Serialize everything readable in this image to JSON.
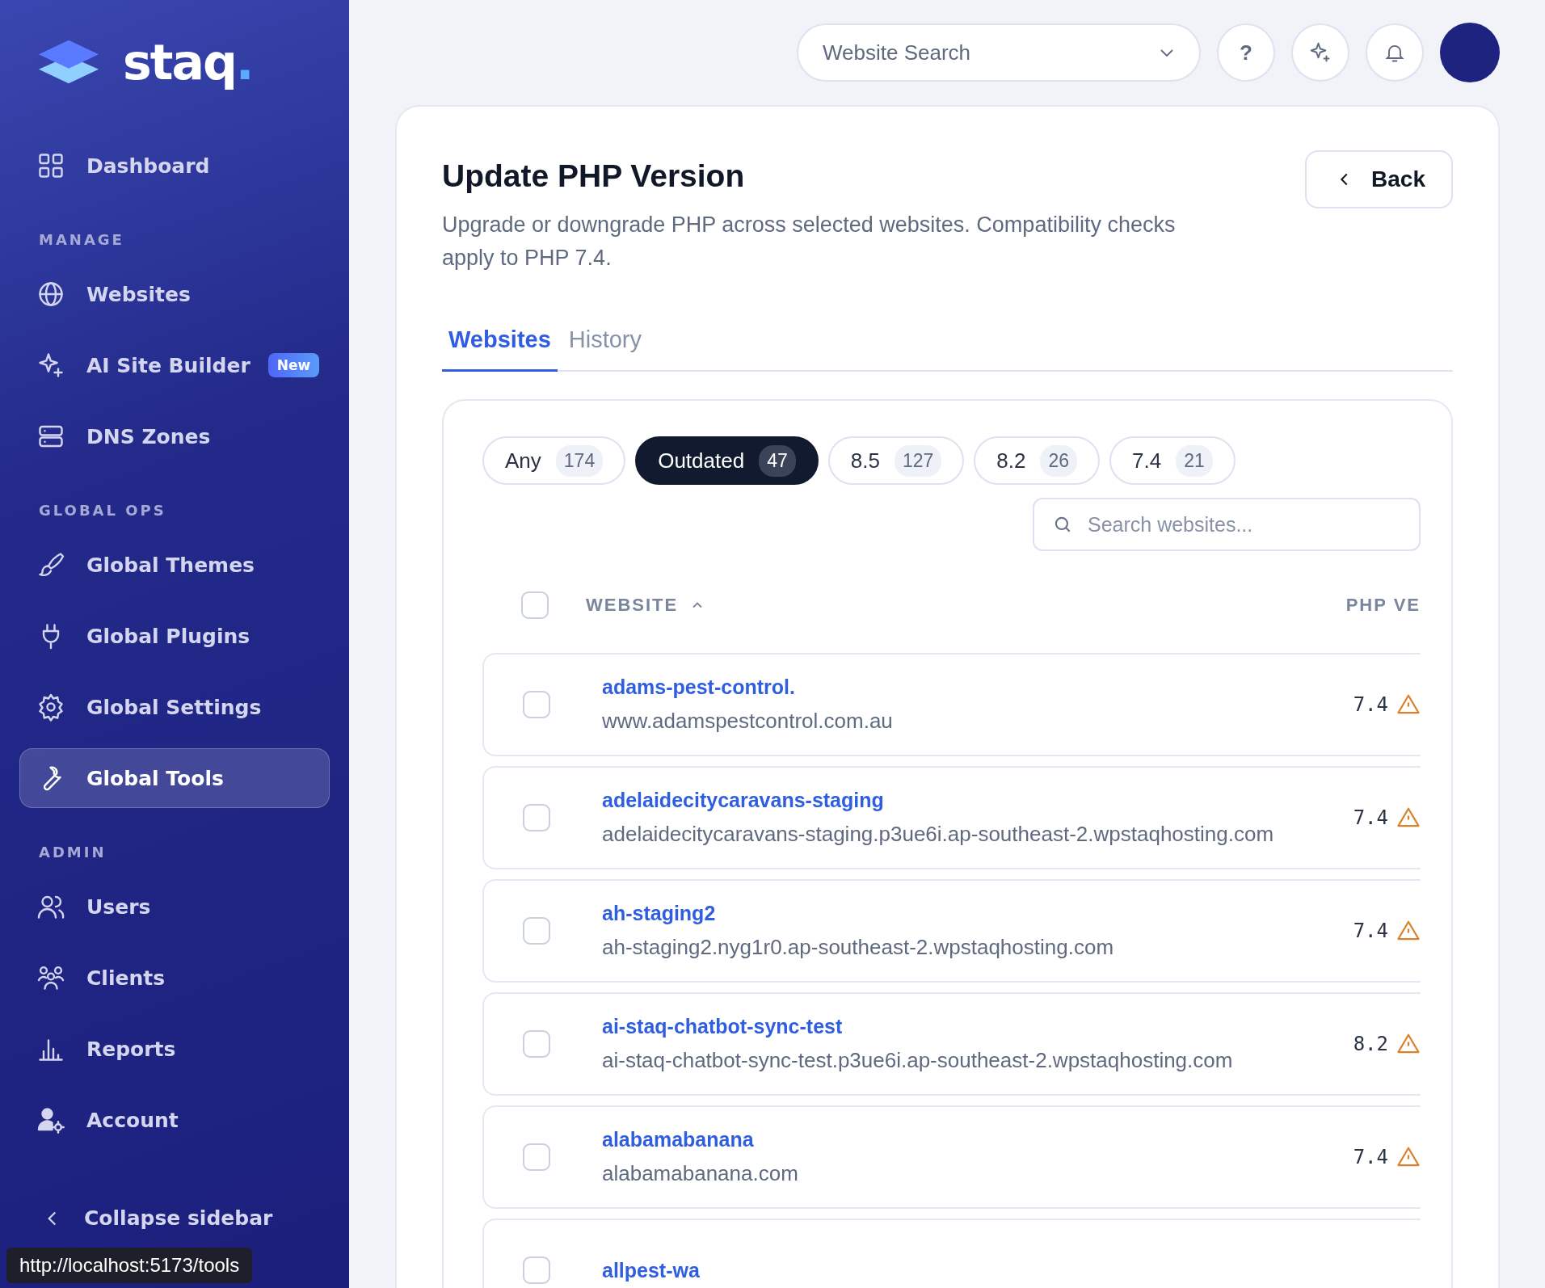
{
  "sidebar": {
    "logo": {
      "text": "staq",
      "dot": "."
    },
    "sections": [
      {
        "items": [
          {
            "label": "Dashboard",
            "selected": false
          }
        ]
      },
      {
        "heading": "MANAGE",
        "items": [
          {
            "label": "Websites",
            "selected": false
          },
          {
            "label": "AI Site Builder",
            "badge": "New",
            "selected": false
          },
          {
            "label": "DNS Zones",
            "selected": false
          }
        ]
      },
      {
        "heading": "GLOBAL OPS",
        "items": [
          {
            "label": "Global Themes",
            "selected": false
          },
          {
            "label": "Global Plugins",
            "selected": false
          },
          {
            "label": "Global Settings",
            "selected": false
          },
          {
            "label": "Global Tools",
            "selected": true
          }
        ]
      },
      {
        "heading": "ADMIN",
        "items": [
          {
            "label": "Users",
            "selected": false
          },
          {
            "label": "Clients",
            "selected": false
          },
          {
            "label": "Reports",
            "selected": false
          },
          {
            "label": "Account",
            "selected": false
          }
        ]
      }
    ],
    "collapse": "Collapse sidebar"
  },
  "link_tooltip": "http://localhost:5173/tools",
  "topbar": {
    "search": {
      "placeholder": "Website Search"
    },
    "help": "?"
  },
  "page": {
    "title": "Update PHP Version",
    "description": "Upgrade or downgrade PHP across selected websites. Compatibility checks apply to PHP 7.4.",
    "back": "Back",
    "tabs": [
      {
        "label": "Websites",
        "selected": true
      },
      {
        "label": "History",
        "selected": false
      }
    ],
    "filters": [
      {
        "label": "Any",
        "count": "174",
        "selected": false
      },
      {
        "label": "Outdated",
        "count": "47",
        "selected": true
      },
      {
        "label": "8.5",
        "count": "127",
        "selected": false
      },
      {
        "label": "8.2",
        "count": "26",
        "selected": false
      },
      {
        "label": "7.4",
        "count": "21",
        "selected": false
      }
    ],
    "search": {
      "placeholder": "Search websites..."
    },
    "table": {
      "select_all": {
        "checked": false
      },
      "columns": [
        "WEBSITE",
        "PHP VE"
      ],
      "rows": [
        {
          "name": "adams-pest-control.",
          "url": "www.adamspestcontrol.com.au",
          "php": "7.4",
          "warning": true,
          "checked": false
        },
        {
          "name": "adelaidecitycaravans-staging",
          "url": "adelaidecitycaravans-staging.p3ue6i.ap-southeast-2.wpstaqhosting.com",
          "php": "7.4",
          "warning": true,
          "checked": false
        },
        {
          "name": "ah-staging2",
          "url": "ah-staging2.nyg1r0.ap-southeast-2.wpstaqhosting.com",
          "php": "7.4",
          "warning": true,
          "checked": false
        },
        {
          "name": "ai-staq-chatbot-sync-test",
          "url": "ai-staq-chatbot-sync-test.p3ue6i.ap-southeast-2.wpstaqhosting.com",
          "php": "8.2",
          "warning": true,
          "checked": false
        },
        {
          "name": "alabamabanana",
          "url": "alabamabanana.com",
          "php": "7.4",
          "warning": true,
          "checked": false
        },
        {
          "name": "allpest-wa",
          "checked": false
        }
      ]
    }
  }
}
